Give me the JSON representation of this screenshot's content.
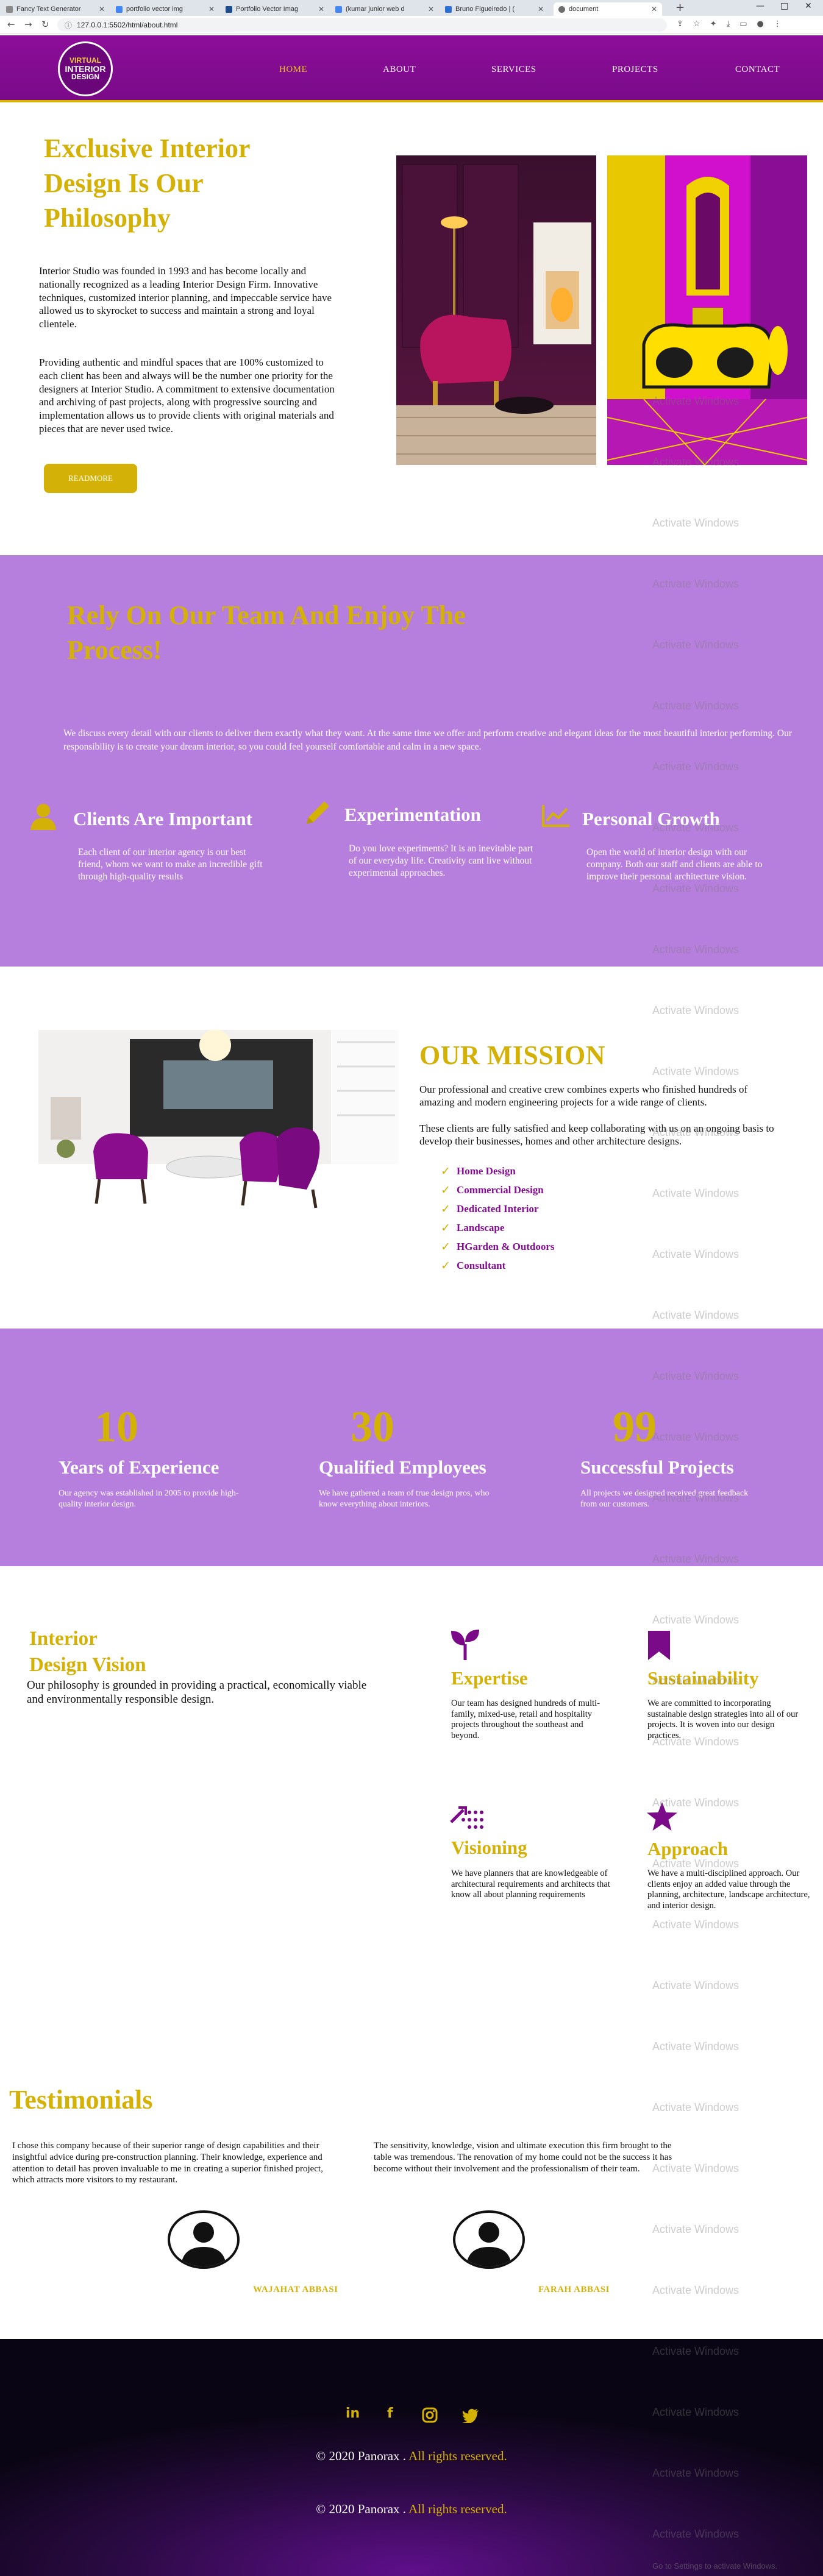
{
  "browser": {
    "tabs": [
      {
        "title": "Fancy Text Generator"
      },
      {
        "title": "portfolio vector img"
      },
      {
        "title": "Portfolio Vector Imag"
      },
      {
        "title": "(kumar junior web d"
      },
      {
        "title": "Bruno Figueiredo | ("
      },
      {
        "title": "document"
      }
    ],
    "new_tab": "+",
    "url": "127.0.0.1:5502/html/about.html",
    "window_controls": [
      "—",
      "□",
      "✕"
    ]
  },
  "site": {
    "logo_lines": [
      "VIRTUAL",
      "INTERIOR",
      "DESIGN"
    ],
    "nav": [
      {
        "label": "HOME",
        "active": true
      },
      {
        "label": "ABOUT",
        "active": false
      },
      {
        "label": "SERVICES",
        "active": false
      },
      {
        "label": "PROJECTS",
        "active": false
      },
      {
        "label": "CONTACT",
        "active": false
      }
    ]
  },
  "about": {
    "title": "Exclusive Interior Design Is Our Philosophy",
    "paragraph1": "Interior Studio was founded in 1993 and has become locally and nationally recognized as a leading Interior Design Firm. Innovative techniques, customized interior planning, and impeccable service have allowed us to skyrocket to success and maintain a strong and loyal clientele.",
    "paragraph2": "Providing authentic and mindful spaces that are 100% customized to each client has been and always will be the number one priority for the designers at Interior Studio. A commitment to extensive documentation and archiving of past projects, along with progressive sourcing and implementation allows us to provide clients with original materials and pieces that are never used twice.",
    "button": "READMORE"
  },
  "process": {
    "title": "Rely On Our Team And Enjoy The Process!",
    "description": "We discuss every detail with our clients to deliver them exactly what they want. At the same time we offer and perform creative and elegant ideas for the most beautiful interior performing. Our responsibility is to create your dream interior, so you could feel yourself comfortable and calm in a new space.",
    "features": [
      {
        "icon": "user-icon",
        "title": "Clients Are Important",
        "text": "Each client of our interior agency is our best friend, whom we want to make an incredible gift through high-quality results"
      },
      {
        "icon": "pencil-icon",
        "title": "Experimentation",
        "text": "Do you love experiments? It is an inevitable part of our everyday life. Creativity cant live without experimental approaches."
      },
      {
        "icon": "chart-icon",
        "title": "Personal Growth",
        "text": "Open the world of interior design with our company. Both our staff and clients are able to improve their personal architecture vision."
      }
    ]
  },
  "mission": {
    "title": "OUR MISSION",
    "paragraph1": "Our professional and creative crew combines experts who finished hundreds of amazing and modern engineering projects for a wide range of clients.",
    "paragraph2": "These clients are fully satisfied and keep collaborating with us on an ongoing basis to develop their businesses, homes and other architecture designs.",
    "items": [
      "Home Design",
      "Commercial Design",
      "Dedicated Interior",
      "Landscape",
      "HGarden & Outdoors",
      "Consultant"
    ]
  },
  "stats": [
    {
      "number": "10",
      "label": "Years of Experience",
      "text": "Our agency was established in 2005 to provide high-quality interior design."
    },
    {
      "number": "30",
      "label": "Qualified Employees",
      "text": "We have gathered a team of true design pros, who know everything about interiors."
    },
    {
      "number": "99",
      "label": "Successful Projects",
      "text": "All projects we designed received great feedback from our customers."
    }
  ],
  "vision": {
    "title_line1": "Interior",
    "title_line2": "Design Vision",
    "paragraph": "Our philosophy is grounded in providing a practical, economically viable and environmentally responsible design.",
    "services": [
      {
        "icon": "sprout-icon",
        "title": "Expertise",
        "text": "Our team has designed hundreds of multi-family, mixed-use, retail and hospitality projects throughout the southeast and beyond."
      },
      {
        "icon": "bookmark-icon",
        "title": "Sustainability",
        "text": "We are committed to incorporating sustainable design strategies into all of our projects. It is woven into our design practices."
      },
      {
        "icon": "magic-wand-icon",
        "title": "Visioning",
        "text": "We have planners that are knowledgeable of architectural requirements and architects that know all about planning requirements"
      },
      {
        "icon": "star-icon",
        "title": "Approach",
        "text": "We have a multi-disciplined approach. Our clients enjoy an added value through the planning, architecture, landscape architecture, and interior design."
      }
    ]
  },
  "testimonials": {
    "title": "Testimonials",
    "items": [
      {
        "text": "I chose this company because of their superior range of design capabilities and their insightful advice during pre-construction planning. Their knowledge, experience and attention to detail has proven invaluable to me in creating a superior finished project, which attracts more visitors to my restaurant.",
        "name": "WAJAHAT ABBASI"
      },
      {
        "text": "The sensitivity, knowledge, vision and ultimate execution this firm brought to the table was tremendous. The renovation of my home could not be the success it has become without their involvement and the professionalism of their team.",
        "name": "FARAH ABBASI"
      }
    ]
  },
  "footer": {
    "social": [
      {
        "icon": "linkedin-icon",
        "glyph": "in"
      },
      {
        "icon": "facebook-icon",
        "glyph": "f"
      },
      {
        "icon": "instagram-icon",
        "glyph": ""
      },
      {
        "icon": "twitter-icon",
        "glyph": ""
      }
    ],
    "copyright_prefix": "© 2020 Panorax .",
    "copyright_suffix": " All rights reserved."
  },
  "watermark": {
    "text": "Activate Windows",
    "settings": "Go to Settings to activate Windows."
  },
  "colors": {
    "purple_nav": "#8c0e9a",
    "lavender": "#b77fdd",
    "gold": "#d4b106",
    "mission_purple": "#870d96"
  }
}
